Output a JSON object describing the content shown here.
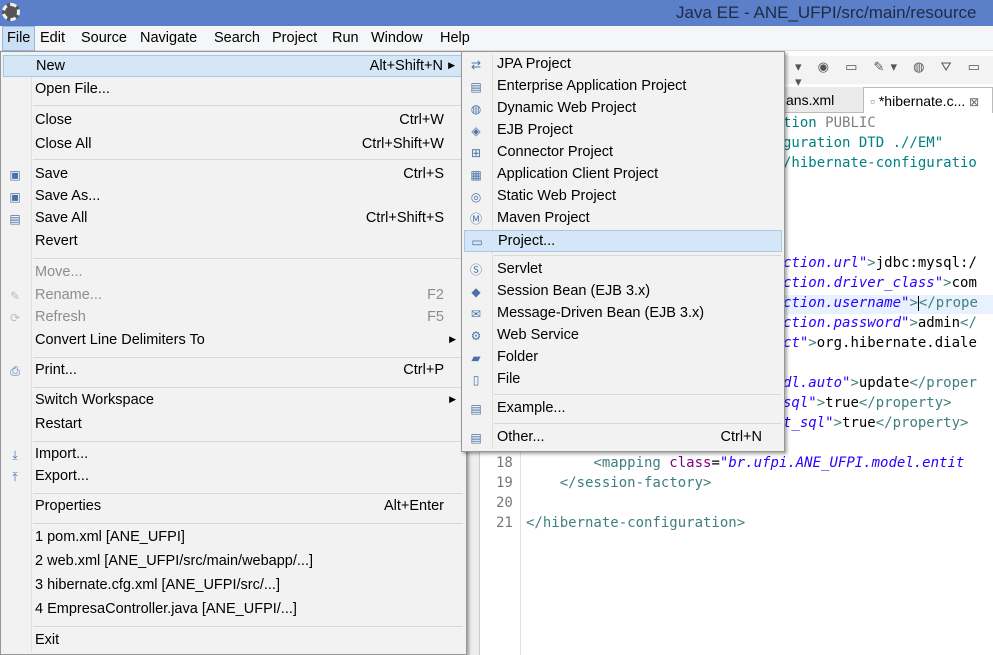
{
  "window": {
    "title": "Java EE - ANE_UFPI/src/main/resource"
  },
  "menubar": [
    "File",
    "Edit",
    "Source",
    "Navigate",
    "Search",
    "Project",
    "Run",
    "Window",
    "Help"
  ],
  "file_menu": [
    {
      "label": "New",
      "shortcut": "Alt+Shift+N",
      "submenu": true,
      "highlighted": true
    },
    {
      "label": "Open File..."
    },
    {
      "sep": true
    },
    {
      "label": "Close",
      "shortcut": "Ctrl+W"
    },
    {
      "label": "Close All",
      "shortcut": "Ctrl+Shift+W"
    },
    {
      "sep": true
    },
    {
      "label": "Save",
      "shortcut": "Ctrl+S",
      "icon": "save-icon"
    },
    {
      "label": "Save As...",
      "icon": "save-as-icon"
    },
    {
      "label": "Save All",
      "shortcut": "Ctrl+Shift+S",
      "icon": "save-all-icon"
    },
    {
      "label": "Revert"
    },
    {
      "sep": true
    },
    {
      "label": "Move...",
      "disabled": true
    },
    {
      "label": "Rename...",
      "shortcut": "F2",
      "disabled": true,
      "icon": "rename-icon"
    },
    {
      "label": "Refresh",
      "shortcut": "F5",
      "disabled": true,
      "icon": "refresh-icon"
    },
    {
      "label": "Convert Line Delimiters To",
      "submenu": true
    },
    {
      "sep": true
    },
    {
      "label": "Print...",
      "shortcut": "Ctrl+P",
      "icon": "print-icon"
    },
    {
      "sep": true
    },
    {
      "label": "Switch Workspace",
      "submenu": true
    },
    {
      "label": "Restart"
    },
    {
      "sep": true
    },
    {
      "label": "Import...",
      "icon": "import-icon"
    },
    {
      "label": "Export...",
      "icon": "export-icon"
    },
    {
      "sep": true
    },
    {
      "label": "Properties",
      "shortcut": "Alt+Enter"
    },
    {
      "sep": true
    },
    {
      "label": "1 pom.xml  [ANE_UFPI]"
    },
    {
      "label": "2 web.xml  [ANE_UFPI/src/main/webapp/...]"
    },
    {
      "label": "3 hibernate.cfg.xml  [ANE_UFPI/src/...]"
    },
    {
      "label": "4 EmpresaController.java  [ANE_UFPI/...]"
    },
    {
      "sep": true
    },
    {
      "label": "Exit"
    }
  ],
  "new_submenu": [
    {
      "label": "JPA Project",
      "icon": "jpa-project-icon"
    },
    {
      "label": "Enterprise Application Project",
      "icon": "ear-project-icon"
    },
    {
      "label": "Dynamic Web Project",
      "icon": "web-project-icon"
    },
    {
      "label": "EJB Project",
      "icon": "ejb-project-icon"
    },
    {
      "label": "Connector Project",
      "icon": "connector-project-icon"
    },
    {
      "label": "Application Client Project",
      "icon": "app-client-icon"
    },
    {
      "label": "Static Web Project",
      "icon": "static-web-icon"
    },
    {
      "label": "Maven Project",
      "icon": "maven-icon"
    },
    {
      "label": "Project...",
      "icon": "project-icon",
      "highlighted": true
    },
    {
      "sep": true
    },
    {
      "label": "Servlet",
      "icon": "servlet-icon"
    },
    {
      "label": "Session Bean (EJB 3.x)",
      "icon": "session-bean-icon"
    },
    {
      "label": "Message-Driven Bean (EJB 3.x)",
      "icon": "mdb-icon"
    },
    {
      "label": "Web Service",
      "icon": "web-service-icon"
    },
    {
      "label": "Folder",
      "icon": "folder-icon"
    },
    {
      "label": "File",
      "icon": "file-icon"
    },
    {
      "sep": true
    },
    {
      "label": "Example...",
      "icon": "example-icon"
    },
    {
      "sep": true
    },
    {
      "label": "Other...",
      "shortcut": "Ctrl+N",
      "icon": "other-icon"
    }
  ],
  "editor": {
    "tabs": [
      {
        "label": "ans.xml"
      },
      {
        "label": "*hibernate.c...",
        "active": true,
        "close": "⊠"
      }
    ],
    "visible_code": [
      {
        "ln": "",
        "parts": [
          [
            "dt",
            "tion "
          ],
          [
            "pub",
            "PUBLIC"
          ]
        ]
      },
      {
        "ln": "",
        "parts": [
          [
            "dt",
            "guration DTD .//EM\""
          ]
        ]
      },
      {
        "ln": "",
        "parts": [
          [
            "dt",
            "/hibernate-configuratio"
          ]
        ]
      },
      {
        "ln": "",
        "parts": [
          [
            "str",
            "ction.url\""
          ],
          [
            "tag",
            ">"
          ],
          [
            "txt",
            "jdbc:mysql:/"
          ]
        ]
      },
      {
        "ln": "",
        "parts": [
          [
            "str",
            "ction.driver_class\""
          ],
          [
            "tag",
            ">"
          ],
          [
            "txt",
            "com"
          ]
        ]
      },
      {
        "ln": "",
        "parts": [
          [
            "str",
            "ction.username\""
          ],
          [
            "tag",
            ">"
          ],
          [
            "cursor",
            ""
          ],
          [
            "tag",
            "</prope"
          ]
        ]
      },
      {
        "ln": "",
        "parts": [
          [
            "str",
            "ction.password\""
          ],
          [
            "tag",
            ">"
          ],
          [
            "txt",
            "admin"
          ],
          [
            "tag",
            "</"
          ]
        ]
      },
      {
        "ln": "",
        "parts": [
          [
            "str",
            "ct\""
          ],
          [
            "tag",
            ">"
          ],
          [
            "txt",
            "org.hibernate.diale"
          ]
        ]
      },
      {
        "ln": "",
        "parts": [
          [
            "str",
            "dl.auto\""
          ],
          [
            "tag",
            ">"
          ],
          [
            "txt",
            "update"
          ],
          [
            "tag",
            "</proper"
          ]
        ]
      },
      {
        "ln": "",
        "parts": [
          [
            "str",
            "sql\""
          ],
          [
            "tag",
            ">"
          ],
          [
            "txt",
            "true"
          ],
          [
            "tag",
            "</property>"
          ]
        ]
      },
      {
        "ln": "",
        "parts": [
          [
            "str",
            "t_sql\""
          ],
          [
            "tag",
            ">"
          ],
          [
            "txt",
            "true"
          ],
          [
            "tag",
            "</property>"
          ]
        ]
      },
      {
        "ln": "18",
        "parts": [
          [
            "tag",
            "        <mapping "
          ],
          [
            "attr",
            "class"
          ],
          [
            "txt",
            "="
          ],
          [
            "str",
            "\"br.ufpi.ANE_UFPI.model.entit"
          ]
        ]
      },
      {
        "ln": "19",
        "parts": [
          [
            "tag",
            "    </session-factory>"
          ]
        ]
      },
      {
        "ln": "20",
        "parts": []
      },
      {
        "ln": "21",
        "parts": [
          [
            "tag",
            "</hibernate-configuration>"
          ]
        ]
      }
    ]
  }
}
